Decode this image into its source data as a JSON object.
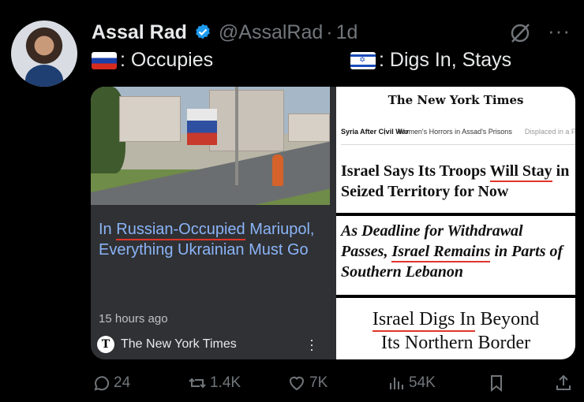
{
  "post": {
    "author_name": "Assal Rad",
    "handle": "@AssalRad",
    "separator": "·",
    "time": "1d",
    "text_ru": ": Occupies",
    "text_il": ": Digs In, Stays"
  },
  "left_card": {
    "title_part1": "In ",
    "title_highlight": "Russian-Occupied",
    "title_part2": " Mariupol, Everything Ukrainian Must Go",
    "time": "15 hours ago",
    "source": "The New York Times",
    "source_logo": "T"
  },
  "nyt1": {
    "masthead": "The New York Times",
    "section": "Syria After Civil War",
    "nav_links": [
      "Women's Horrors in Assad's Prisons",
      "Displaced in a F"
    ],
    "headline_part1": "Israel Says Its Troops ",
    "headline_highlight": "Will Stay",
    "headline_part2": " in Seized Territory for Now"
  },
  "nyt2": {
    "headline_part1": "As Deadline for Withdrawal Passes, ",
    "headline_highlight": "Israel Remains",
    "headline_part2": " in Parts of Southern Lebanon"
  },
  "nyt3": {
    "headline_highlight": "Israel Digs In",
    "headline_part1": " Beyond",
    "headline_part2": "Its Northern Border"
  },
  "actions": {
    "replies": "24",
    "reposts": "1.4K",
    "likes": "7K",
    "views": "54K"
  },
  "colors": {
    "background": "#000000",
    "muted": "#71767b",
    "verified": "#1d9bf0",
    "link_blue": "#8ab4f8",
    "highlight_red": "#e0352b"
  },
  "icons": [
    "verified-badge-icon",
    "grok-icon",
    "more-icon",
    "reply-icon",
    "repost-icon",
    "like-icon",
    "views-icon",
    "bookmark-icon",
    "share-icon",
    "kebab-menu-icon"
  ]
}
